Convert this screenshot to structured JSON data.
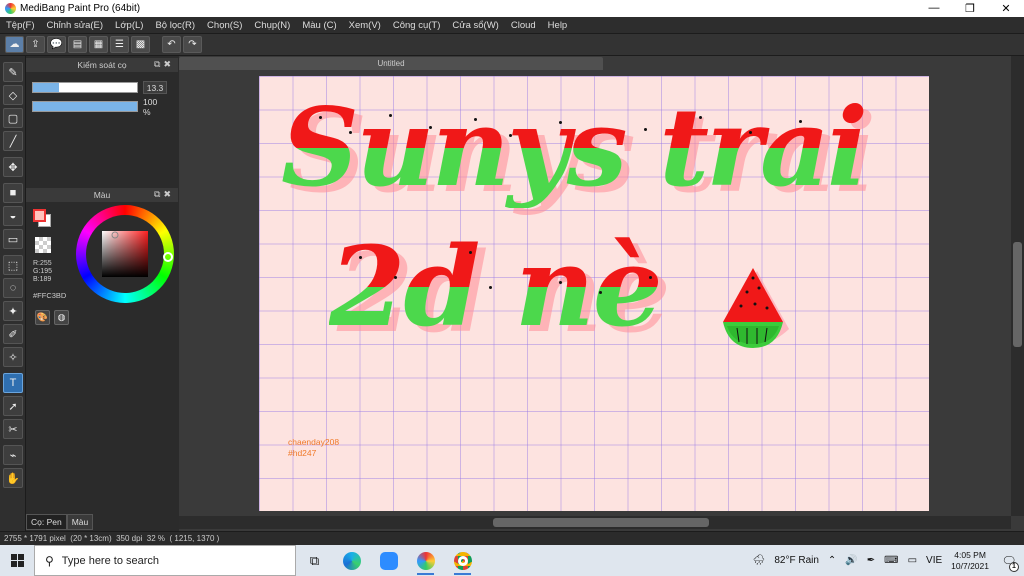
{
  "window": {
    "title": "MediBang Paint Pro (64bit)",
    "minimize": "—",
    "restore": "❐",
    "close": "✕"
  },
  "menu": [
    "Tệp(F)",
    "Chỉnh sửa(E)",
    "Lớp(L)",
    "Bộ lọc(R)",
    "Chọn(S)",
    "Chụp(N)",
    "Màu (C)",
    "Xem(V)",
    "Công cụ(T)",
    "Cửa sổ(W)",
    "Cloud",
    "Help"
  ],
  "brush_panel": {
    "title": "Kiểm soát cọ",
    "size_value": "13.3",
    "size_fraction": 0.25,
    "opacity_value": "100 %",
    "opacity_fraction": 1.0
  },
  "color_panel": {
    "title": "Màu",
    "foreground": "#FFC3BD",
    "r": "R:255",
    "g": "G:195",
    "b": "B:189",
    "hex": "#FFC3BD"
  },
  "panel_tabs": {
    "brush": "Cọ: Pen",
    "color": "Màu"
  },
  "document": {
    "tab": "Untitled",
    "line1": "Sunys trai",
    "line2": "2d nè",
    "credit1": "chaenday208",
    "credit2": "#hd247"
  },
  "status": {
    "size": "2755 * 1791 pixel",
    "cm": "(20 * 13cm)",
    "dpi": "350 dpi",
    "zoom": "32 %",
    "coords": "( 1215, 1370 )"
  },
  "taskbar": {
    "search_placeholder": "Type here to search",
    "weather": "82°F  Rain",
    "lang": "VIE",
    "time": "4:05 PM",
    "date": "10/7/2021",
    "notif_count": "1"
  },
  "colors": {
    "accent_red": "#f01818",
    "accent_green": "#4cd84c",
    "canvas_bg": "#fde3e0",
    "credit": "#f07a2a"
  }
}
